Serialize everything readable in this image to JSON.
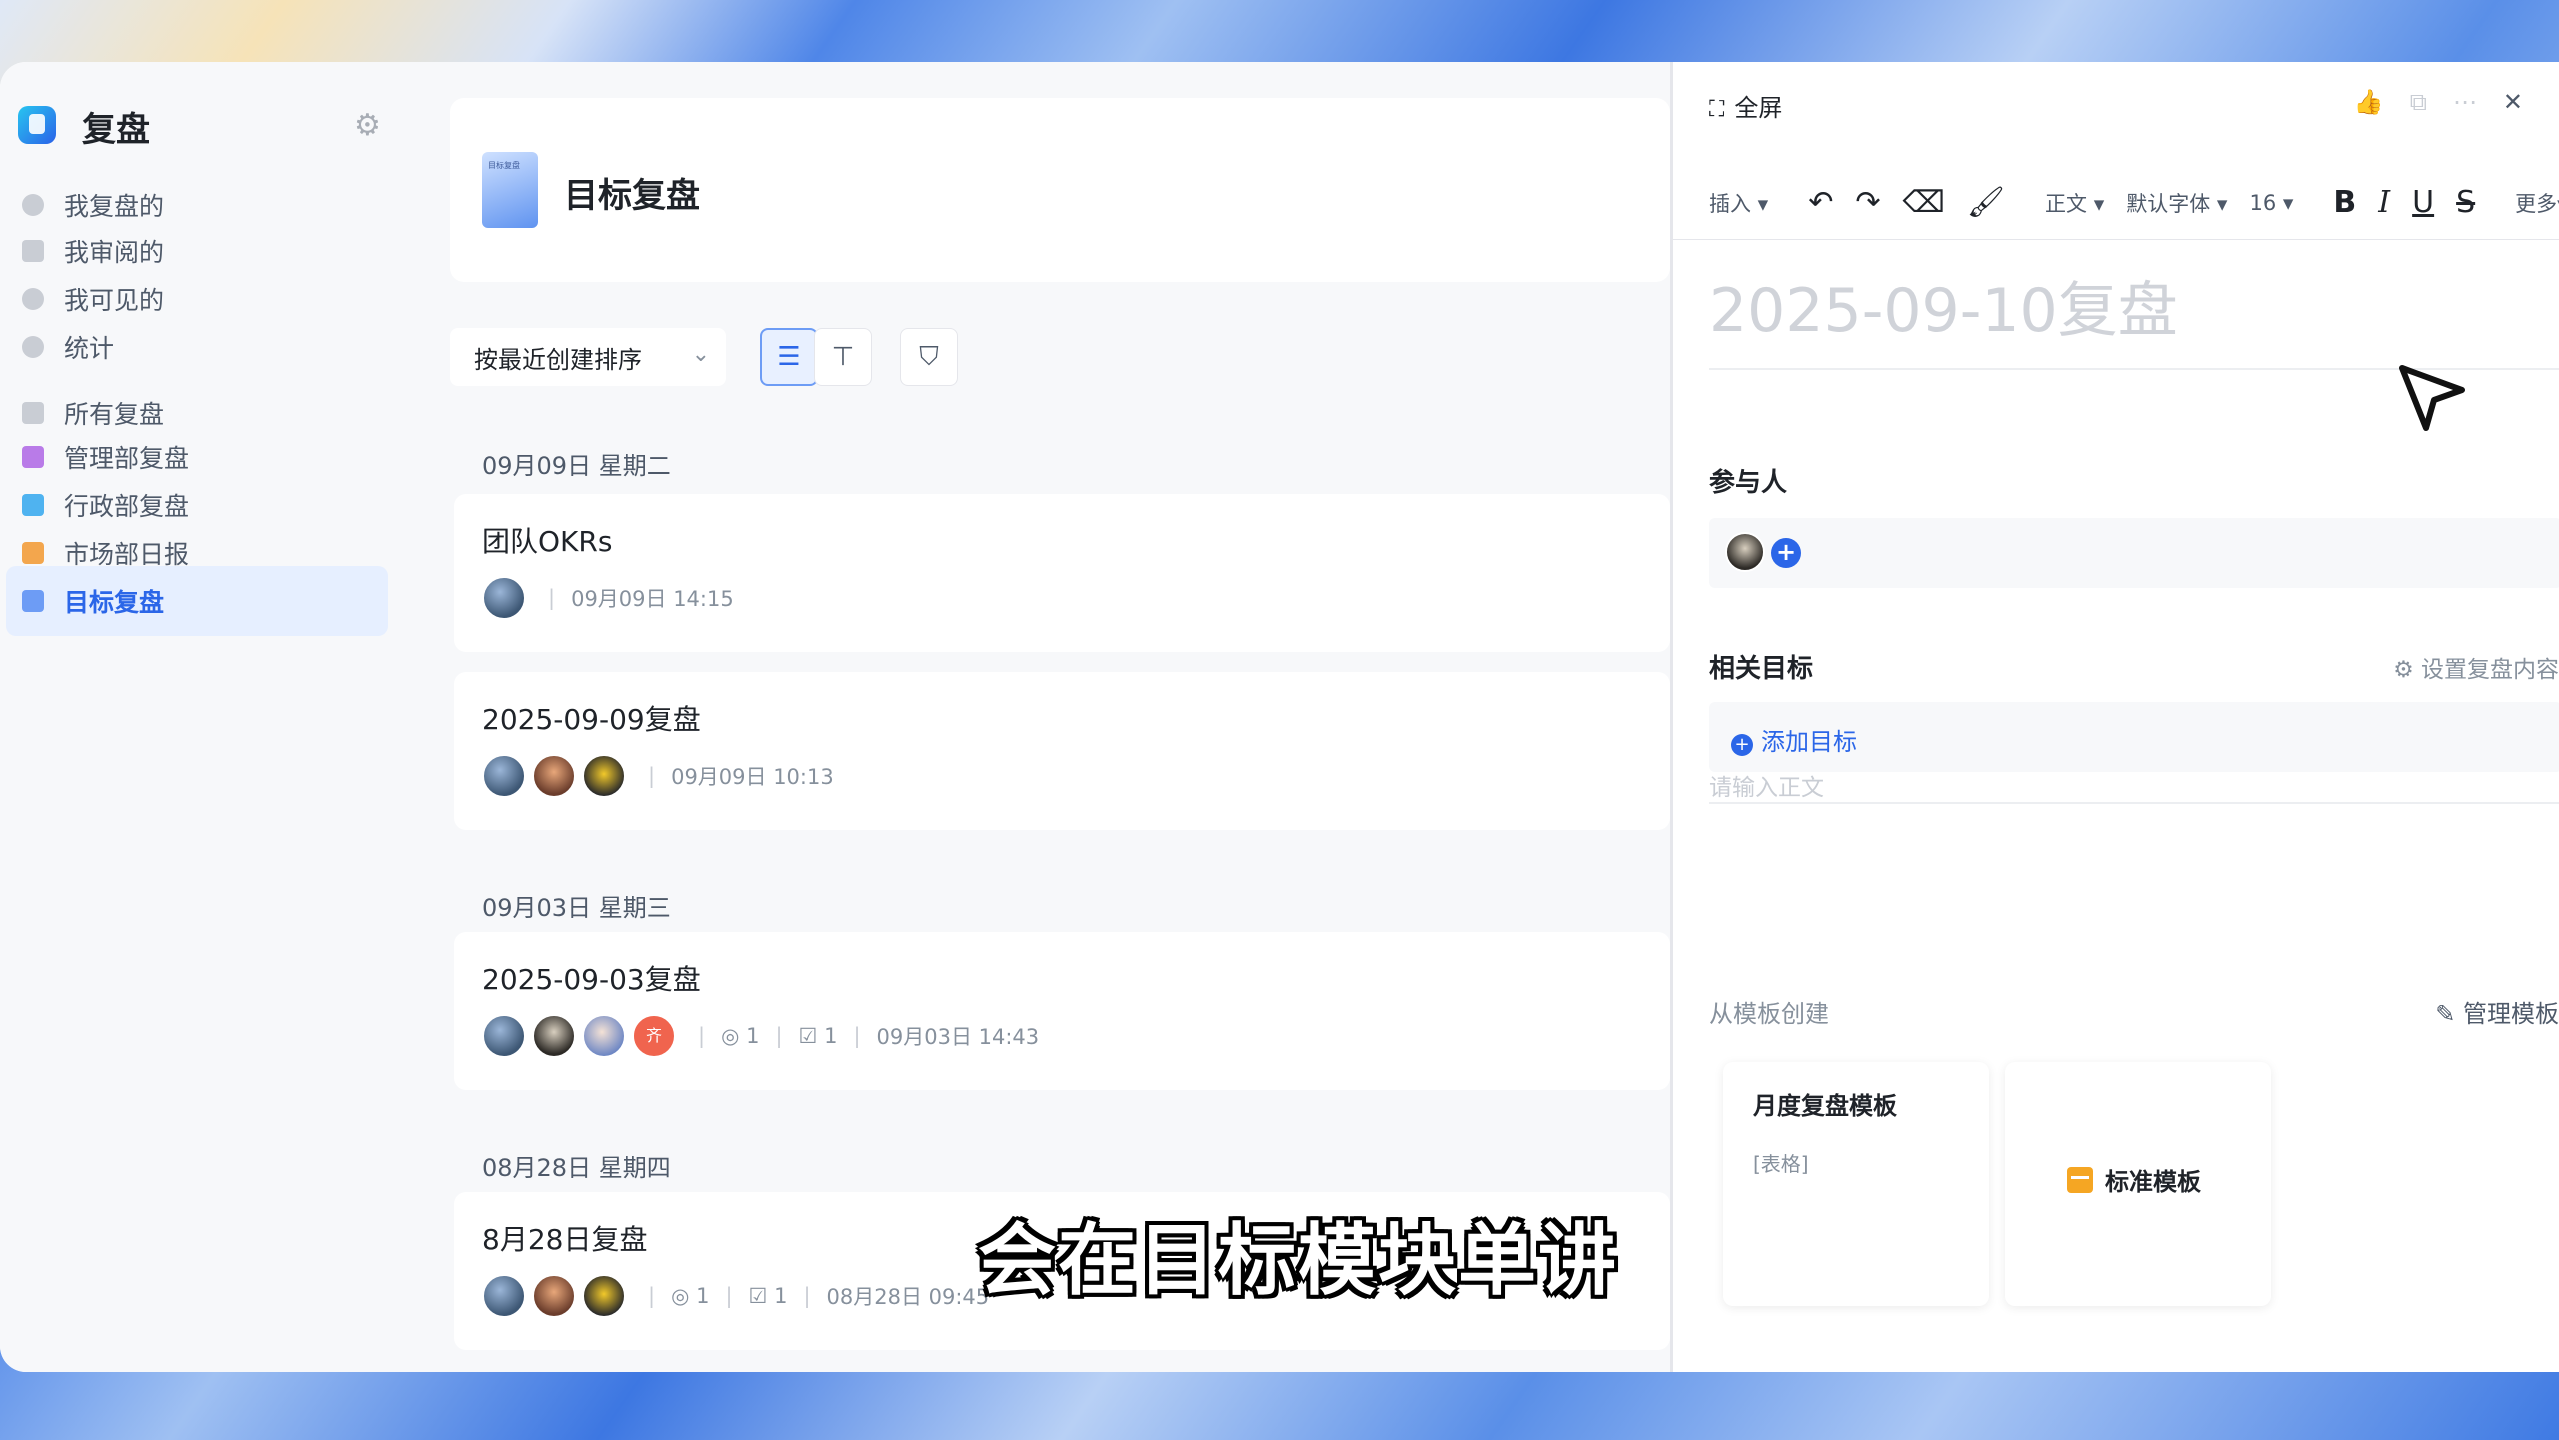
{
  "sidebar": {
    "app_title": "复盘",
    "items": [
      {
        "label": "我复盘的"
      },
      {
        "label": "我审阅的"
      },
      {
        "label": "我可见的"
      },
      {
        "label": "统计"
      },
      {
        "label": "所有复盘"
      },
      {
        "label": "管理部复盘"
      },
      {
        "label": "行政部复盘"
      },
      {
        "label": "市场部日报"
      },
      {
        "label": "目标复盘"
      }
    ],
    "active_item": "目标复盘"
  },
  "main": {
    "title": "目标复盘",
    "book_label": "目标复盘",
    "sort_label": "按最近创建排序",
    "groups": [
      {
        "date": "09月09日 星期二",
        "items": [
          {
            "title": "团队OKRs",
            "time": "09月09日 14:15"
          },
          {
            "title": "2025-09-09复盘",
            "time": "09月09日 10:13"
          }
        ]
      },
      {
        "date": "09月03日 星期三",
        "items": [
          {
            "title": "2025-09-03复盘",
            "goals": "1",
            "tasks": "1",
            "time": "09月03日 14:43",
            "avatar_text": "齐"
          }
        ]
      },
      {
        "date": "08月28日 星期四",
        "items": [
          {
            "title": "8月28日复盘",
            "goals": "1",
            "tasks": "1",
            "time": "08月28日 09:45"
          }
        ]
      }
    ]
  },
  "panel": {
    "fullscreen_label": "全屏",
    "toolbar": {
      "insert": "插入",
      "style": "正文",
      "font": "默认字体",
      "size": "16",
      "more": "更多"
    },
    "doc_title_placeholder": "2025-09-10复盘",
    "participants_label": "参与人",
    "related_goals_label": "相关目标",
    "settings_link": "设置复盘内容",
    "add_goal_label": "添加目标",
    "body_placeholder": "请输入正文",
    "from_template_label": "从模板创建",
    "manage_template_label": "管理模板",
    "templates": [
      {
        "title": "月度复盘模板",
        "subtitle": "[表格]"
      },
      {
        "title": "标准模板"
      }
    ]
  },
  "subtitle": "会在目标模块单讲",
  "colors": {
    "accent": "#2b66e8",
    "active_bg": "#e6efff"
  }
}
